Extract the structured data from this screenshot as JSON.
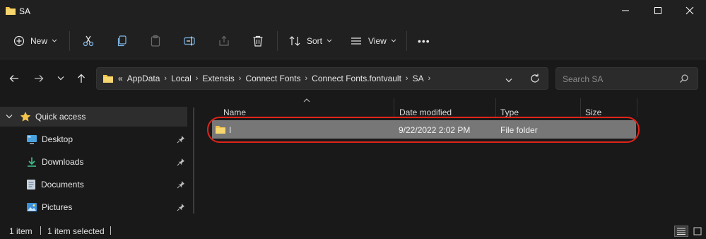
{
  "window": {
    "title": "SA"
  },
  "toolbar": {
    "new_label": "New",
    "sort_label": "Sort",
    "view_label": "View",
    "more_label": "•••"
  },
  "address": {
    "overflow": "«",
    "crumbs": [
      "AppData",
      "Local",
      "Extensis",
      "Connect Fonts",
      "Connect Fonts.fontvault",
      "SA"
    ],
    "search_placeholder": "Search SA"
  },
  "sidebar": {
    "items": [
      {
        "label": "Quick access",
        "icon": "star-icon"
      },
      {
        "label": "Desktop",
        "icon": "desktop-icon"
      },
      {
        "label": "Downloads",
        "icon": "download-icon"
      },
      {
        "label": "Documents",
        "icon": "documents-icon"
      },
      {
        "label": "Pictures",
        "icon": "pictures-icon"
      }
    ]
  },
  "columns": {
    "name": "Name",
    "date": "Date modified",
    "type": "Type",
    "size": "Size"
  },
  "files": [
    {
      "name": "I",
      "date": "9/22/2022 2:02 PM",
      "type": "File folder",
      "size": ""
    }
  ],
  "status": {
    "count": "1 item",
    "selected": "1 item selected"
  },
  "colors": {
    "accent": "#e0241b",
    "folder": "#f2c44d",
    "selection": "#777777"
  }
}
